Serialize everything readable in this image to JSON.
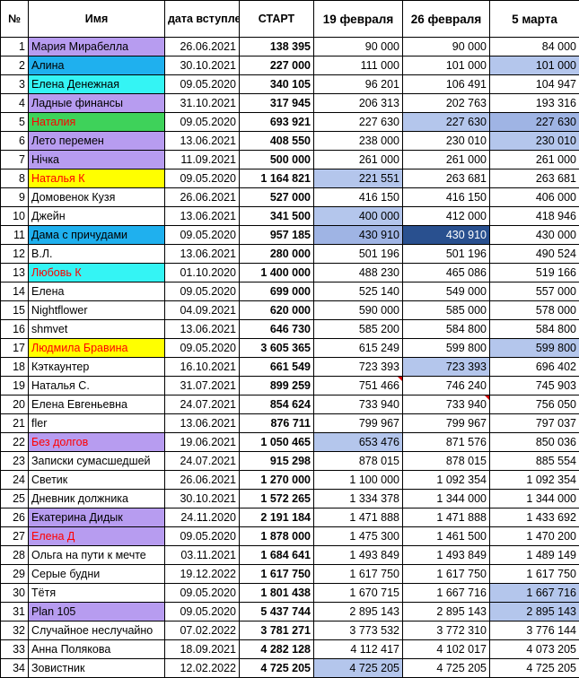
{
  "headers": [
    "№",
    "Имя",
    "дата вступления",
    "СТАРТ",
    "19 февраля",
    "26 февраля",
    "5 марта"
  ],
  "colors": {
    "purple": "#b79cf0",
    "blue": "#1fb0ee",
    "cyan": "#34f4f4",
    "green": "#3ed25a",
    "yellow": "#ffff00",
    "lightblue": "#b4c6ec",
    "midblue": "#9fb4e4",
    "darkblue": "#29508f",
    "red": "#ff0000"
  },
  "rows": [
    {
      "n": "1",
      "name": "Мария Мирабелла",
      "date": "26.06.2021",
      "start": "138 395",
      "v1": "90 000",
      "v2": "90 000",
      "v3": "84 000",
      "nameBg": "purple"
    },
    {
      "n": "2",
      "name": "Алина",
      "date": "30.10.2021",
      "start": "227 000",
      "v1": "111 000",
      "v2": "101 000",
      "v3": "101 000",
      "nameBg": "blue",
      "v3Bg": "lightblue"
    },
    {
      "n": "3",
      "name": "Елена Денежная",
      "date": "09.05.2020",
      "start": "340 105",
      "v1": "96 201",
      "v2": "106 491",
      "v3": "104 947",
      "nameBg": "cyan"
    },
    {
      "n": "4",
      "name": "Ладные финансы",
      "date": "31.10.2021",
      "start": "317 945",
      "v1": "206 313",
      "v2": "202 763",
      "v3": "193 316",
      "nameBg": "purple"
    },
    {
      "n": "5",
      "name": "Наталия",
      "date": "09.05.2020",
      "start": "693 921",
      "v1": "227 630",
      "v2": "227 630",
      "v3": "227 630",
      "nameBg": "green",
      "nameColor": "red",
      "v2Bg": "lightblue",
      "v3Bg": "midblue"
    },
    {
      "n": "6",
      "name": "Лето перемен",
      "date": "13.06.2021",
      "start": "408 550",
      "v1": "238 000",
      "v2": "230 010",
      "v3": "230 010",
      "nameBg": "purple",
      "v3Bg": "lightblue"
    },
    {
      "n": "7",
      "name": "Нічка",
      "date": "11.09.2021",
      "start": "500 000",
      "v1": "261 000",
      "v2": "261 000",
      "v3": "261 000",
      "nameBg": "purple"
    },
    {
      "n": "8",
      "name": "Наталья К",
      "date": "09.05.2020",
      "start": "1 164 821",
      "v1": "221 551",
      "v2": "263 681",
      "v3": "263 681",
      "nameBg": "yellow",
      "nameColor": "red",
      "v1Bg": "lightblue"
    },
    {
      "n": "9",
      "name": "Домовенок Кузя",
      "date": "26.06.2021",
      "start": "527 000",
      "v1": "416 150",
      "v2": "416 150",
      "v3": "406 000"
    },
    {
      "n": "10",
      "name": "Джейн",
      "date": "13.06.2021",
      "start": "341 500",
      "v1": "400 000",
      "v2": "412 000",
      "v3": "418 946",
      "v1Bg": "lightblue"
    },
    {
      "n": "11",
      "name": "Дама с причудами",
      "date": "09.05.2020",
      "start": "957 185",
      "v1": "430 910",
      "v2": "430 910",
      "v3": "430 000",
      "nameBg": "blue",
      "v1Bg": "midblue",
      "v2Bg": "darkblue",
      "v2Color": "#ffffff"
    },
    {
      "n": "12",
      "name": "В.Л.",
      "date": "13.06.2021",
      "start": "280 000",
      "v1": "501 196",
      "v2": "501 196",
      "v3": "490 524"
    },
    {
      "n": "13",
      "name": "Любовь К",
      "date": "01.10.2020",
      "start": "1 400 000",
      "v1": "488 230",
      "v2": "465 086",
      "v3": "519 166",
      "nameBg": "cyan",
      "nameColor": "red"
    },
    {
      "n": "14",
      "name": "Елена",
      "date": "09.05.2020",
      "start": "699 000",
      "v1": "525 140",
      "v2": "549 000",
      "v3": "557 000"
    },
    {
      "n": "15",
      "name": "Nightflower",
      "date": "04.09.2021",
      "start": "620 000",
      "v1": "590 000",
      "v2": "585 000",
      "v3": "578 000"
    },
    {
      "n": "16",
      "name": "shmvet",
      "date": "13.06.2021",
      "start": "646 730",
      "v1": "585 200",
      "v2": "584 800",
      "v3": "584 800"
    },
    {
      "n": "17",
      "name": "Людмила Бравина",
      "date": "09.05.2020",
      "start": "3 605 365",
      "v1": "615 249",
      "v2": "599 800",
      "v3": "599 800",
      "nameBg": "yellow",
      "nameColor": "red",
      "v3Bg": "lightblue"
    },
    {
      "n": "18",
      "name": "Кэткаунтер",
      "date": "16.10.2021",
      "start": "661 549",
      "v1": "723 393",
      "v2": "723 393",
      "v3": "696 402",
      "v2Bg": "lightblue"
    },
    {
      "n": "19",
      "name": "Наталья С.",
      "date": "31.07.2021",
      "start": "899 259",
      "v1": "751 466",
      "v2": "746 240",
      "v3": "745 903",
      "v1Flag": true
    },
    {
      "n": "20",
      "name": "Елена Евгеньевна",
      "date": "24.07.2021",
      "start": "854 624",
      "v1": "733 940",
      "v2": "733 940",
      "v3": "756 050",
      "v2Flag": true
    },
    {
      "n": "21",
      "name": "fler",
      "date": "13.06.2021",
      "start": "876 711",
      "v1": "799 967",
      "v2": "799 967",
      "v3": "797 037"
    },
    {
      "n": "22",
      "name": "Без долгов",
      "date": "19.06.2021",
      "start": "1 050 465",
      "v1": "653 476",
      "v2": "871 576",
      "v3": "850 036",
      "nameBg": "purple",
      "nameColor": "red",
      "v1Bg": "lightblue"
    },
    {
      "n": "23",
      "name": "Записки сумасшедшей",
      "date": "24.07.2021",
      "start": "915 298",
      "v1": "878 015",
      "v2": "878 015",
      "v3": "885 554"
    },
    {
      "n": "24",
      "name": "Светик",
      "date": "26.06.2021",
      "start": "1 270 000",
      "v1": "1 100 000",
      "v2": "1 092 354",
      "v3": "1 092 354"
    },
    {
      "n": "25",
      "name": "Дневник должника",
      "date": "30.10.2021",
      "start": "1 572 265",
      "v1": "1 334 378",
      "v2": "1 344 000",
      "v3": "1 344 000"
    },
    {
      "n": "26",
      "name": "Екатерина Дидык",
      "date": "24.11.2020",
      "start": "2 191 184",
      "v1": "1 471 888",
      "v2": "1 471 888",
      "v3": "1 433 692",
      "nameBg": "purple"
    },
    {
      "n": "27",
      "name": "Елена Д",
      "date": "09.05.2020",
      "start": "1 878 000",
      "v1": "1 475 300",
      "v2": "1 461 500",
      "v3": "1 470 200",
      "nameBg": "purple",
      "nameColor": "red"
    },
    {
      "n": "28",
      "name": "Ольга на пути к мечте",
      "date": "03.11.2021",
      "start": "1 684 641",
      "v1": "1 493 849",
      "v2": "1 493 849",
      "v3": "1 489 149"
    },
    {
      "n": "29",
      "name": "Серые будни",
      "date": "19.12.2022",
      "start": "1 617 750",
      "v1": "1 617 750",
      "v2": "1 617 750",
      "v3": "1 617 750"
    },
    {
      "n": "30",
      "name": "Тётя",
      "date": "09.05.2020",
      "start": "1 801 438",
      "v1": "1 670 715",
      "v2": "1 667 716",
      "v3": "1 667 716",
      "v3Bg": "lightblue"
    },
    {
      "n": "31",
      "name": "Plan 105",
      "date": "09.05.2020",
      "start": "5 437 744",
      "v1": "2 895 143",
      "v2": "2 895 143",
      "v3": "2 895 143",
      "nameBg": "purple",
      "v3Bg": "lightblue"
    },
    {
      "n": "32",
      "name": "Случайное неслучайно",
      "date": "07.02.2022",
      "start": "3 781 271",
      "v1": "3 773 532",
      "v2": "3 772 310",
      "v3": "3 776 144"
    },
    {
      "n": "33",
      "name": "Анна Полякова",
      "date": "18.09.2021",
      "start": "4 282 128",
      "v1": "4 112 417",
      "v2": "4 102 017",
      "v3": "4 073 205"
    },
    {
      "n": "34",
      "name": "Зовистник",
      "date": "12.02.2022",
      "start": "4 725 205",
      "v1": "4 725 205",
      "v2": "4 725 205",
      "v3": "4 725 205",
      "v1Bg": "lightblue"
    }
  ]
}
